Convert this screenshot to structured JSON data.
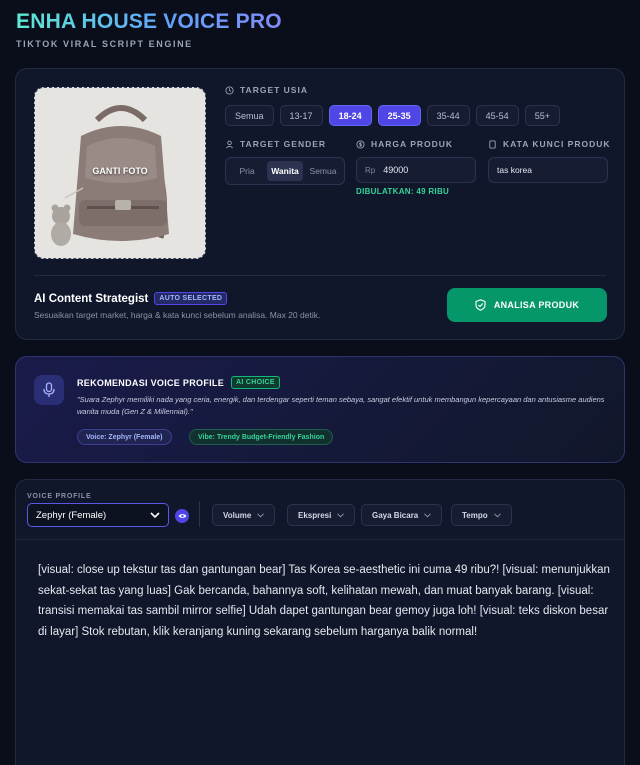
{
  "header": {
    "title": "ENHA HOUSE VOICE PRO",
    "subtitle": "TIKTOK VIRAL SCRIPT ENGINE"
  },
  "product": {
    "change_photo_label": "GANTI FOTO",
    "target_age_label": "TARGET USIA",
    "age_options": [
      {
        "label": "Semua",
        "active": false
      },
      {
        "label": "13-17",
        "active": false
      },
      {
        "label": "18-24",
        "active": true
      },
      {
        "label": "25-35",
        "active": true
      },
      {
        "label": "35-44",
        "active": false
      },
      {
        "label": "45-54",
        "active": false
      },
      {
        "label": "55+",
        "active": false
      }
    ],
    "target_gender_label": "TARGET GENDER",
    "gender_options": [
      {
        "label": "Pria",
        "active": false
      },
      {
        "label": "Wanita",
        "active": true
      },
      {
        "label": "Semua",
        "active": false
      }
    ],
    "price_label": "HARGA PRODUK",
    "price_prefix": "Rp",
    "price_value": "49000",
    "price_rounded": "DIBULATKAN: 49 RIBU",
    "keyword_label": "KATA KUNCI PRODUK",
    "keyword_value": "tas korea"
  },
  "strategist": {
    "title": "AI Content Strategist",
    "badge": "AUTO SELECTED",
    "description": "Sesuaikan target market, harga & kata kunci sebelum analisa. Max 20 detik.",
    "analyze_button": "ANALISA PRODUK"
  },
  "recommendation": {
    "title": "REKOMENDASI VOICE PROFILE",
    "badge": "AI CHOICE",
    "quote": "\"Suara Zephyr memiliki nada yang ceria, energik, dan terdengar seperti teman sebaya, sangat efektif untuk membangun kepercayaan dan antusiasme audiens wanita muda (Gen Z & Millennial).\"",
    "voice_tag": "Voice: Zephyr (Female)",
    "vibe_tag": "Vibe: Trendy Budget-Friendly Fashion"
  },
  "editor": {
    "voice_profile_label": "VOICE PROFILE",
    "voice_profile_value": "Zephyr (Female)",
    "dropdowns": {
      "volume": "Volume",
      "expression": "Ekspresi",
      "style": "Gaya Bicara",
      "tempo": "Tempo"
    },
    "script": "[visual: close up tekstur tas dan gantungan bear] Tas Korea se-aesthetic ini cuma 49 ribu?! [visual: menunjukkan sekat-sekat tas yang luas] Gak bercanda, bahannya soft, kelihatan mewah, dan muat banyak barang. [visual: transisi memakai tas sambil mirror selfie] Udah dapet gantungan bear gemoy juga loh! [visual: teks diskon besar di layar] Stok rebutan, klik keranjang kuning sekarang sebelum harganya balik normal!"
  },
  "colors": {
    "accent": "#4f46e5",
    "success": "#059669",
    "background": "#0a0e1a"
  }
}
